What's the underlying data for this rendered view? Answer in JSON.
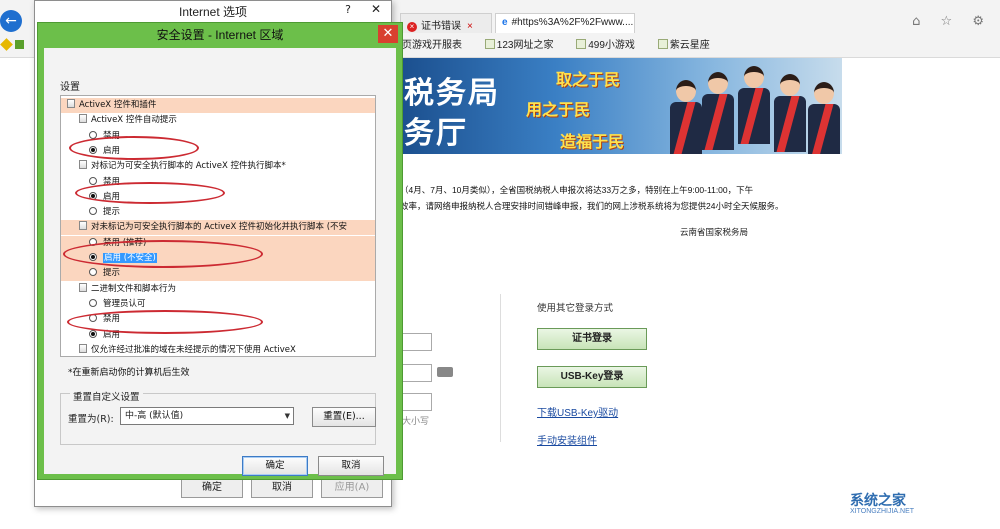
{
  "browser": {
    "tabs": [
      {
        "label": "证书错误",
        "close": "×"
      },
      {
        "label": "#https%3A%2F%2Fwww....",
        "close": "×"
      }
    ],
    "favorites": [
      "网页游戏开服表",
      "123网址之家",
      "499小游戏",
      "紫云星座"
    ],
    "nav_icons": "⌂ ☆ ⚙",
    "back_icon": "←",
    "close_glyph": "✕",
    "watermark": "系统之家",
    "watermark_sub": "XITONGZHIJIA.NET"
  },
  "page": {
    "banner_title_1": "税务局",
    "banner_title_2": "务厅",
    "slogans": [
      "取之于民",
      "用之于民",
      "造福于民"
    ],
    "notice_line_1": "（4月、7月、10月类似），全省国税纳税人申报次将达33万之多，特别在上午9:00-11:00，下午",
    "notice_line_2": "效率，请网络申报纳税人合理安排时间错峰申报，我们的网上涉税系统将为您提供24小时全天候服务。",
    "signature": "云南省国家税务局",
    "other_login": "使用其它登录方式",
    "cert_login": "证书登录",
    "usbkey_login": "USB-Key登录",
    "download_driver": "下载USB-Key驱动",
    "manual_install": "手动安装组件",
    "case_hint": "大小写"
  },
  "internet_options": {
    "title": "Internet 选项",
    "help": "?",
    "ok": "确定",
    "cancel": "取消",
    "apply": "应用(A)"
  },
  "security_dialog": {
    "title": "安全设置 - Internet 区域",
    "close": "✕",
    "settings_label": "设置",
    "rows": [
      {
        "type": "group",
        "text": "ActiveX 控件和插件",
        "highlight": true
      },
      {
        "type": "item",
        "text": "ActiveX 控件自动提示"
      },
      {
        "type": "radio",
        "text": "禁用",
        "checked": false
      },
      {
        "type": "radio",
        "text": "启用",
        "checked": true
      },
      {
        "type": "item",
        "text": "对标记为可安全执行脚本的 ActiveX 控件执行脚本*"
      },
      {
        "type": "radio",
        "text": "禁用",
        "checked": false
      },
      {
        "type": "radio",
        "text": "启用",
        "checked": true
      },
      {
        "type": "radio",
        "text": "提示",
        "checked": false
      },
      {
        "type": "item",
        "text": "对未标记为可安全执行脚本的 ActiveX 控件初始化并执行脚本 (不安",
        "highlight": true
      },
      {
        "type": "radio",
        "text": "禁用 (推荐)",
        "checked": false,
        "highlight": true
      },
      {
        "type": "radio",
        "text": "启用 (不安全)",
        "checked": true,
        "selected": true,
        "highlight": true
      },
      {
        "type": "radio",
        "text": "提示",
        "checked": false,
        "highlight": true
      },
      {
        "type": "item",
        "text": "二进制文件和脚本行为"
      },
      {
        "type": "radio",
        "text": "管理员认可",
        "checked": false
      },
      {
        "type": "radio",
        "text": "禁用",
        "checked": false
      },
      {
        "type": "radio",
        "text": "启用",
        "checked": true
      },
      {
        "type": "item",
        "text": "仅允许经过批准的域在未经提示的情况下使用 ActiveX"
      }
    ],
    "restart_note": "*在重新启动你的计算机后生效",
    "reset_group_label": "重置自定义设置",
    "reset_to_label": "重置为(R):",
    "reset_value": "中-高 (默认值)",
    "reset_button": "重置(E)...",
    "ok": "确定",
    "cancel": "取消",
    "accent_color": "#6cbf4a",
    "annotation_color": "#cc2a32"
  }
}
